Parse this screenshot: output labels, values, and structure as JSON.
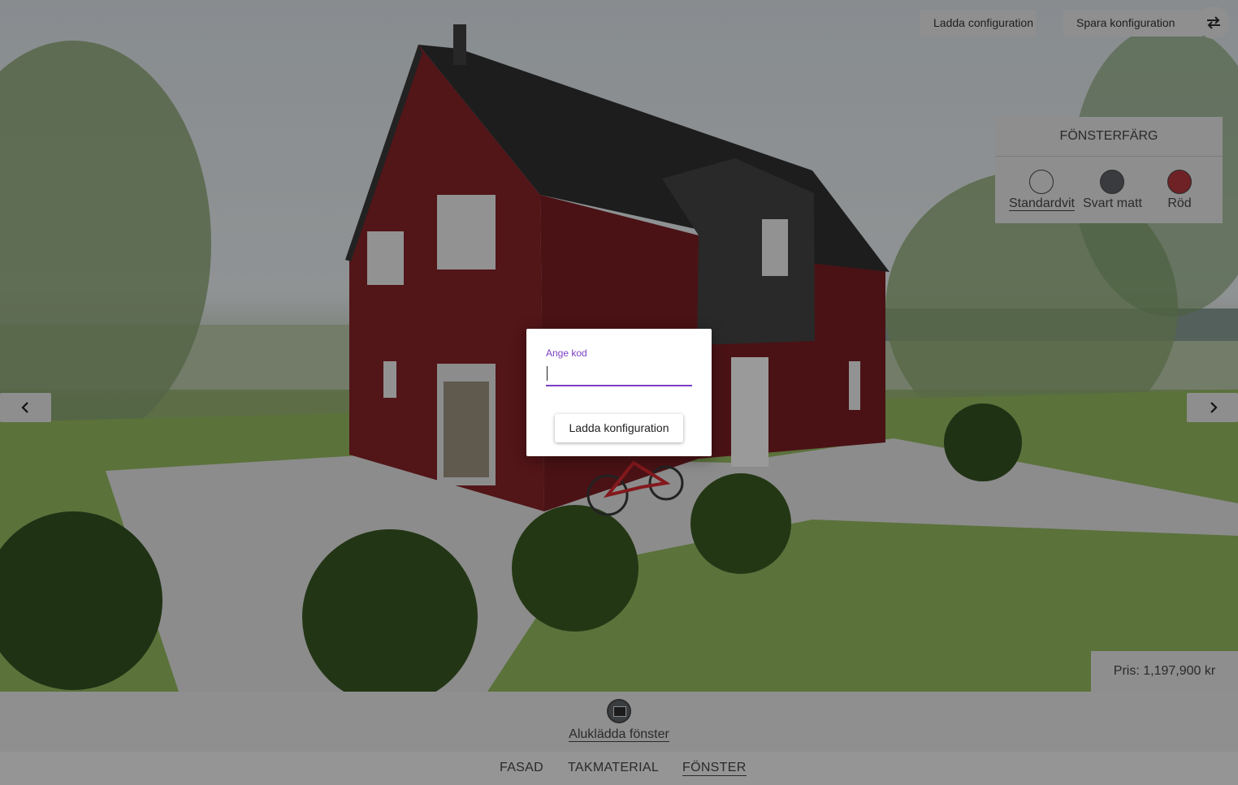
{
  "top": {
    "load_label": "Ladda configuration",
    "save_label": "Spara konfiguration",
    "swap_icon": "swap-arrows-icon"
  },
  "color_panel": {
    "title": "FÖNSTERFÄRG",
    "options": [
      {
        "label": "Standardvit",
        "color": "#e8e8e8",
        "selected": true
      },
      {
        "label": "Svart matt",
        "color": "#2e2f31",
        "selected": false
      },
      {
        "label": "Röd",
        "color": "#7a1f24",
        "selected": false
      }
    ]
  },
  "nav": {
    "prev_icon": "chevron-left-icon",
    "next_icon": "chevron-right-icon"
  },
  "price": {
    "text": "Pris: 1,197,900 kr"
  },
  "options_bar": {
    "item_label": "Aluklädda fönster"
  },
  "tabs": [
    "FASAD",
    "TAKMATERIAL",
    "FÖNSTER"
  ],
  "active_tab": "FÖNSTER",
  "dialog": {
    "field_label": "Ange kod",
    "field_value": "",
    "button_label": "Ladda konfiguration"
  },
  "colors": {
    "accent": "#7b3fc4",
    "house_wall": "#7a1f24",
    "roof": "#2b2b2b"
  }
}
